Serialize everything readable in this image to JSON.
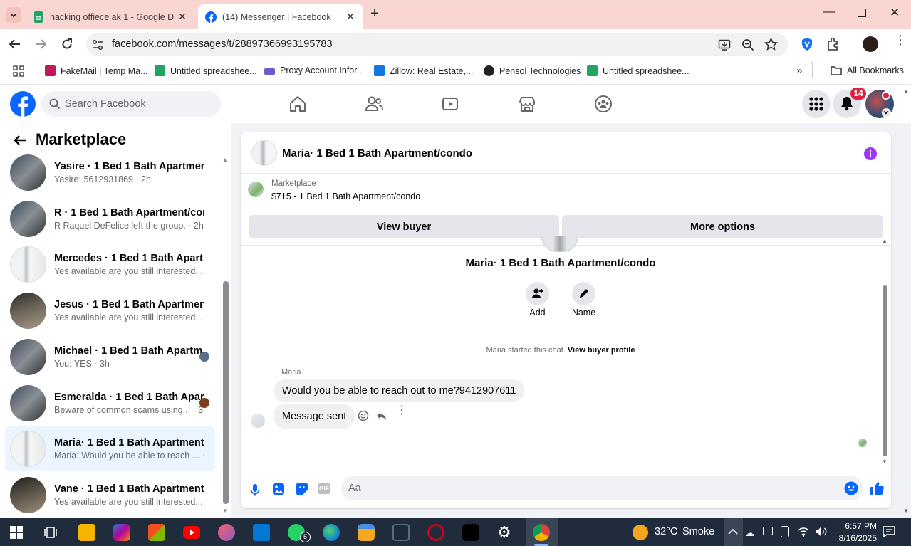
{
  "browser": {
    "tabs": [
      {
        "title": "hacking offiece ak 1 - Google D",
        "icon": "google-sheets-icon"
      },
      {
        "title": "(14) Messenger | Facebook",
        "icon": "facebook-icon",
        "active": true
      }
    ],
    "url": "facebook.com/messages/t/28897366993195783",
    "bookmarks": [
      {
        "label": "FakeMail | Temp Ma..."
      },
      {
        "label": "Untitled spreadshee..."
      },
      {
        "label": "Proxy Account Infor..."
      },
      {
        "label": "Zillow: Real Estate,..."
      },
      {
        "label": "Pensol Technologies"
      },
      {
        "label": "Untitled spreadshee..."
      }
    ],
    "all_bookmarks": "All Bookmarks"
  },
  "facebook": {
    "search_placeholder": "Search Facebook",
    "notification_count": "14"
  },
  "sidebar": {
    "title": "Marketplace",
    "conversations": [
      {
        "name": "Yasire · 1 Bed 1 Bath Apartment/...",
        "preview": "Yasire: 5612931869 · 2h"
      },
      {
        "name": "R · 1 Bed 1 Bath Apartment/condo",
        "preview": "R Raquel DeFelice left the group. · 2h"
      },
      {
        "name": "Mercedes · 1 Bed 1 Bath Apartm...",
        "preview": "Yes available are you still interested... 2h"
      },
      {
        "name": "Jesus · 1 Bed 1 Bath Apartment/...",
        "preview": "Yes available are you still interested... 2h"
      },
      {
        "name": "Michael · 1 Bed 1 Bath Apartm...",
        "preview": "You: YES · 3h"
      },
      {
        "name": "Esmeralda · 1 Bed 1 Bath Apar...",
        "preview": "Beware of common scams using... · 3h"
      },
      {
        "name": "Maria· 1 Bed 1 Bath Apartment/...",
        "preview": "Maria: Would you be able to reach ... · 3h",
        "active": true
      },
      {
        "name": "Vane · 1 Bed 1 Bath Apartment/c...",
        "preview": "Yes available are you still interested... 4h"
      }
    ]
  },
  "chat": {
    "title": "Maria· 1 Bed 1 Bath Apartment/condo",
    "listing_source": "Marketplace",
    "listing": "$715 - 1 Bed 1 Bath Apartment/condo",
    "view_buyer": "View buyer",
    "more_options": "More options",
    "group_name": "Maria· 1 Bed 1 Bath Apartment/condo",
    "add_label": "Add",
    "name_label": "Name",
    "started_text": "Maria started this chat.",
    "view_buyer_profile": "View buyer profile",
    "sender": "Maria",
    "messages": [
      {
        "text": "Would you be able to reach out to me?9412907611"
      },
      {
        "text": "Message sent"
      }
    ],
    "composer_placeholder": "Aa"
  },
  "taskbar": {
    "weather_temp": "32°C",
    "weather_desc": "Smoke",
    "time": "6:57 PM",
    "date": "8/16/2025",
    "whatsapp_badge": "5"
  },
  "colors": {
    "fb_blue": "#0866ff",
    "purple": "#a033ff",
    "tab_strip": "#f9d6d2"
  }
}
